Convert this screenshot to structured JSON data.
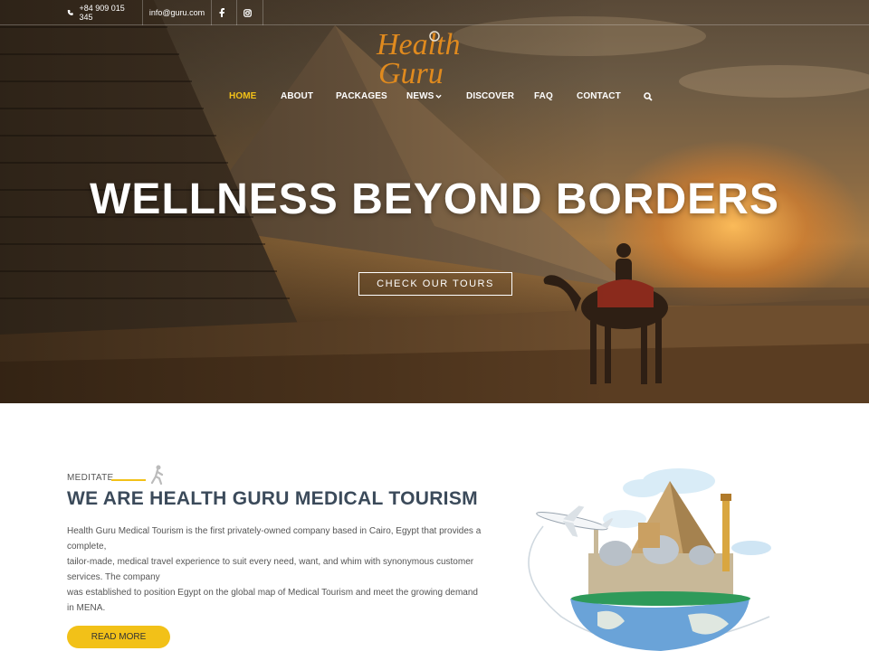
{
  "topbar": {
    "phone": "+84 909 015 345",
    "email": "info@guru.com",
    "social": [
      "facebook-icon",
      "instagram-icon"
    ]
  },
  "logo": {
    "line1": "Health",
    "line2": "Guru"
  },
  "nav": {
    "items": [
      {
        "label": "HOME"
      },
      {
        "label": "ABOUT"
      },
      {
        "label": "PACKAGES"
      },
      {
        "label": "NEWS"
      },
      {
        "label": "DISCOVER"
      },
      {
        "label": "FAQ"
      },
      {
        "label": "CONTACT"
      }
    ],
    "active": "HOME"
  },
  "hero": {
    "title": "WELLNESS BEYOND BORDERS",
    "button": "CHECK OUR TOURS"
  },
  "about": {
    "eyebrow": "MEDITATE",
    "title": "WE ARE HEALTH GURU MEDICAL TOURISM",
    "lines": [
      "Health Guru Medical Tourism is the first privately-owned company based in Cairo, Egypt that provides a",
      "complete,",
      "tailor-made, medical travel experience to suit every need, want, and whim with synonymous customer",
      "services. The company",
      "was established to position Egypt on the global map of Medical Tourism and meet the growing demand",
      "in MENA."
    ],
    "button": "READ MORE"
  },
  "colors": {
    "accent": "#f2c118",
    "heading": "#3b4a5a",
    "logo": "#e08a1e"
  }
}
